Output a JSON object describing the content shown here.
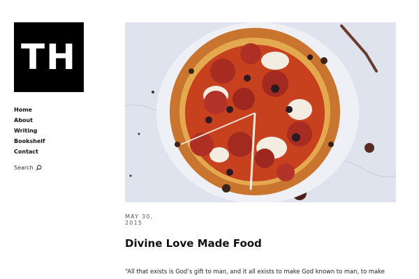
{
  "site": {
    "logo_text": "TH"
  },
  "nav": {
    "items": [
      "Home",
      "About",
      "Writing",
      "Bookshelf",
      "Contact"
    ]
  },
  "search": {
    "label": "Search",
    "icon": "search-icon"
  },
  "post": {
    "image": "pizza-photo",
    "date_line1": "MAY 30,",
    "date_line2": "2015",
    "title": "Divine Love Made Food",
    "excerpt": "“All that exists is God’s gift to man, and it all exists to make God known to man, to make"
  }
}
